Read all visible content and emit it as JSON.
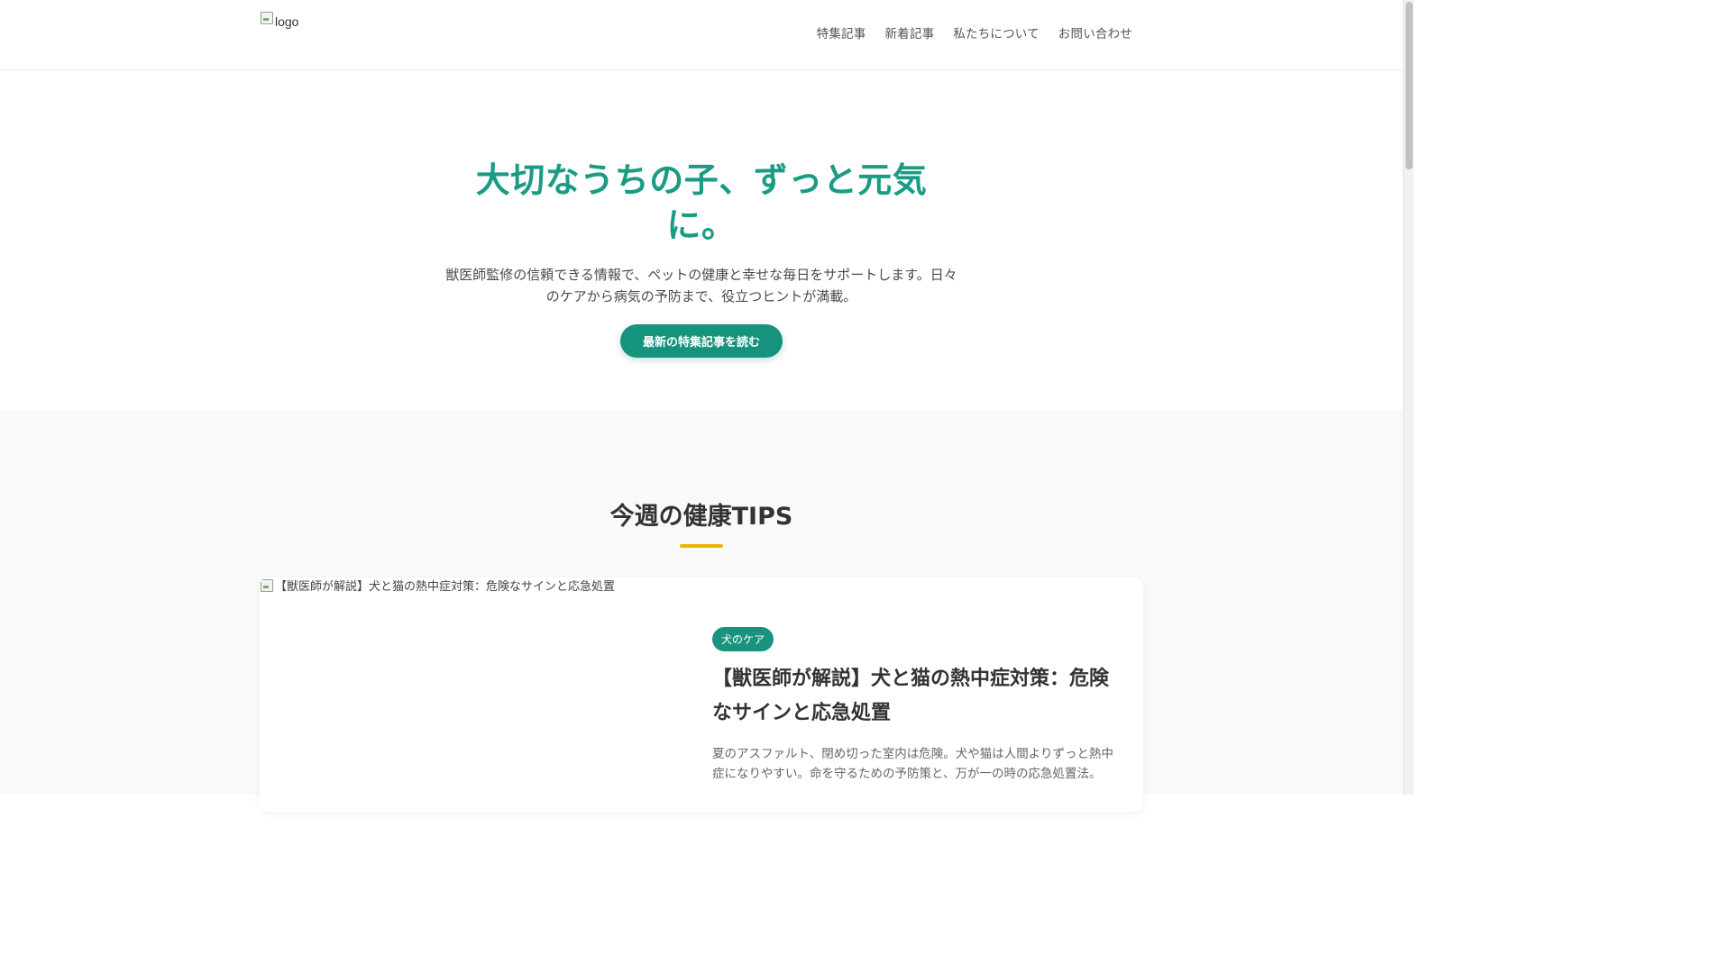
{
  "header": {
    "logo_alt": "logo",
    "nav": [
      {
        "label": "特集記事"
      },
      {
        "label": "新着記事"
      },
      {
        "label": "私たちについて"
      },
      {
        "label": "お問い合わせ"
      }
    ]
  },
  "hero": {
    "title": "大切なうちの子、ずっと元気に。",
    "subtitle": "獣医師監修の信頼できる情報で、ペットの健康と幸せな毎日をサポートします。日々のケアから病気の予防まで、役立つヒントが満載。",
    "cta_label": "最新の特集記事を読む"
  },
  "tips": {
    "heading": "今週の健康TIPS",
    "card": {
      "image_alt": "【獣医師が解説】犬と猫の熱中症対策：危険なサインと応急処置",
      "tag": "犬のケア",
      "title": "【獣医師が解説】犬と猫の熱中症対策：危険なサインと応急処置",
      "excerpt": "夏のアスファルト、閉め切った室内は危険。犬や猫は人間よりずっと熱中症になりやすい。命を守るための予防策と、万が一の時の応急処置法。"
    }
  },
  "colors": {
    "brand_green": "#16937c",
    "accent_yellow": "#f0b400"
  }
}
